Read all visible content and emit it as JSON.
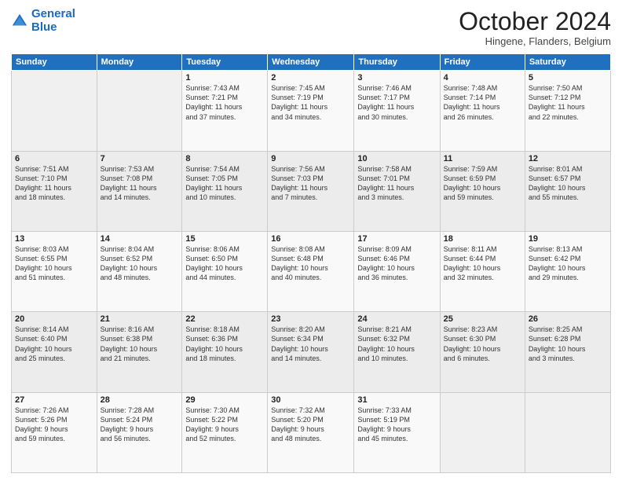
{
  "header": {
    "logo_line1": "General",
    "logo_line2": "Blue",
    "month": "October 2024",
    "location": "Hingene, Flanders, Belgium"
  },
  "days_of_week": [
    "Sunday",
    "Monday",
    "Tuesday",
    "Wednesday",
    "Thursday",
    "Friday",
    "Saturday"
  ],
  "weeks": [
    [
      {
        "day": "",
        "sunrise": "",
        "sunset": "",
        "daylight": ""
      },
      {
        "day": "",
        "sunrise": "",
        "sunset": "",
        "daylight": ""
      },
      {
        "day": "1",
        "sunrise": "Sunrise: 7:43 AM",
        "sunset": "Sunset: 7:21 PM",
        "daylight": "Daylight: 11 hours and 37 minutes."
      },
      {
        "day": "2",
        "sunrise": "Sunrise: 7:45 AM",
        "sunset": "Sunset: 7:19 PM",
        "daylight": "Daylight: 11 hours and 34 minutes."
      },
      {
        "day": "3",
        "sunrise": "Sunrise: 7:46 AM",
        "sunset": "Sunset: 7:17 PM",
        "daylight": "Daylight: 11 hours and 30 minutes."
      },
      {
        "day": "4",
        "sunrise": "Sunrise: 7:48 AM",
        "sunset": "Sunset: 7:14 PM",
        "daylight": "Daylight: 11 hours and 26 minutes."
      },
      {
        "day": "5",
        "sunrise": "Sunrise: 7:50 AM",
        "sunset": "Sunset: 7:12 PM",
        "daylight": "Daylight: 11 hours and 22 minutes."
      }
    ],
    [
      {
        "day": "6",
        "sunrise": "Sunrise: 7:51 AM",
        "sunset": "Sunset: 7:10 PM",
        "daylight": "Daylight: 11 hours and 18 minutes."
      },
      {
        "day": "7",
        "sunrise": "Sunrise: 7:53 AM",
        "sunset": "Sunset: 7:08 PM",
        "daylight": "Daylight: 11 hours and 14 minutes."
      },
      {
        "day": "8",
        "sunrise": "Sunrise: 7:54 AM",
        "sunset": "Sunset: 7:05 PM",
        "daylight": "Daylight: 11 hours and 10 minutes."
      },
      {
        "day": "9",
        "sunrise": "Sunrise: 7:56 AM",
        "sunset": "Sunset: 7:03 PM",
        "daylight": "Daylight: 11 hours and 7 minutes."
      },
      {
        "day": "10",
        "sunrise": "Sunrise: 7:58 AM",
        "sunset": "Sunset: 7:01 PM",
        "daylight": "Daylight: 11 hours and 3 minutes."
      },
      {
        "day": "11",
        "sunrise": "Sunrise: 7:59 AM",
        "sunset": "Sunset: 6:59 PM",
        "daylight": "Daylight: 10 hours and 59 minutes."
      },
      {
        "day": "12",
        "sunrise": "Sunrise: 8:01 AM",
        "sunset": "Sunset: 6:57 PM",
        "daylight": "Daylight: 10 hours and 55 minutes."
      }
    ],
    [
      {
        "day": "13",
        "sunrise": "Sunrise: 8:03 AM",
        "sunset": "Sunset: 6:55 PM",
        "daylight": "Daylight: 10 hours and 51 minutes."
      },
      {
        "day": "14",
        "sunrise": "Sunrise: 8:04 AM",
        "sunset": "Sunset: 6:52 PM",
        "daylight": "Daylight: 10 hours and 48 minutes."
      },
      {
        "day": "15",
        "sunrise": "Sunrise: 8:06 AM",
        "sunset": "Sunset: 6:50 PM",
        "daylight": "Daylight: 10 hours and 44 minutes."
      },
      {
        "day": "16",
        "sunrise": "Sunrise: 8:08 AM",
        "sunset": "Sunset: 6:48 PM",
        "daylight": "Daylight: 10 hours and 40 minutes."
      },
      {
        "day": "17",
        "sunrise": "Sunrise: 8:09 AM",
        "sunset": "Sunset: 6:46 PM",
        "daylight": "Daylight: 10 hours and 36 minutes."
      },
      {
        "day": "18",
        "sunrise": "Sunrise: 8:11 AM",
        "sunset": "Sunset: 6:44 PM",
        "daylight": "Daylight: 10 hours and 32 minutes."
      },
      {
        "day": "19",
        "sunrise": "Sunrise: 8:13 AM",
        "sunset": "Sunset: 6:42 PM",
        "daylight": "Daylight: 10 hours and 29 minutes."
      }
    ],
    [
      {
        "day": "20",
        "sunrise": "Sunrise: 8:14 AM",
        "sunset": "Sunset: 6:40 PM",
        "daylight": "Daylight: 10 hours and 25 minutes."
      },
      {
        "day": "21",
        "sunrise": "Sunrise: 8:16 AM",
        "sunset": "Sunset: 6:38 PM",
        "daylight": "Daylight: 10 hours and 21 minutes."
      },
      {
        "day": "22",
        "sunrise": "Sunrise: 8:18 AM",
        "sunset": "Sunset: 6:36 PM",
        "daylight": "Daylight: 10 hours and 18 minutes."
      },
      {
        "day": "23",
        "sunrise": "Sunrise: 8:20 AM",
        "sunset": "Sunset: 6:34 PM",
        "daylight": "Daylight: 10 hours and 14 minutes."
      },
      {
        "day": "24",
        "sunrise": "Sunrise: 8:21 AM",
        "sunset": "Sunset: 6:32 PM",
        "daylight": "Daylight: 10 hours and 10 minutes."
      },
      {
        "day": "25",
        "sunrise": "Sunrise: 8:23 AM",
        "sunset": "Sunset: 6:30 PM",
        "daylight": "Daylight: 10 hours and 6 minutes."
      },
      {
        "day": "26",
        "sunrise": "Sunrise: 8:25 AM",
        "sunset": "Sunset: 6:28 PM",
        "daylight": "Daylight: 10 hours and 3 minutes."
      }
    ],
    [
      {
        "day": "27",
        "sunrise": "Sunrise: 7:26 AM",
        "sunset": "Sunset: 5:26 PM",
        "daylight": "Daylight: 9 hours and 59 minutes."
      },
      {
        "day": "28",
        "sunrise": "Sunrise: 7:28 AM",
        "sunset": "Sunset: 5:24 PM",
        "daylight": "Daylight: 9 hours and 56 minutes."
      },
      {
        "day": "29",
        "sunrise": "Sunrise: 7:30 AM",
        "sunset": "Sunset: 5:22 PM",
        "daylight": "Daylight: 9 hours and 52 minutes."
      },
      {
        "day": "30",
        "sunrise": "Sunrise: 7:32 AM",
        "sunset": "Sunset: 5:20 PM",
        "daylight": "Daylight: 9 hours and 48 minutes."
      },
      {
        "day": "31",
        "sunrise": "Sunrise: 7:33 AM",
        "sunset": "Sunset: 5:19 PM",
        "daylight": "Daylight: 9 hours and 45 minutes."
      },
      {
        "day": "",
        "sunrise": "",
        "sunset": "",
        "daylight": ""
      },
      {
        "day": "",
        "sunrise": "",
        "sunset": "",
        "daylight": ""
      }
    ]
  ]
}
